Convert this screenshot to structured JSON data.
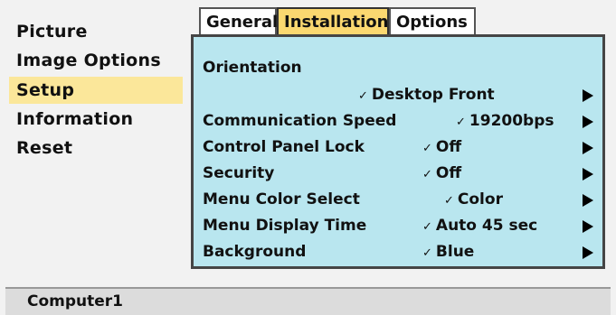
{
  "menu": {
    "items": [
      {
        "label": "Picture",
        "selected": false
      },
      {
        "label": "Image Options",
        "selected": false
      },
      {
        "label": "Setup",
        "selected": true
      },
      {
        "label": "Information",
        "selected": false
      },
      {
        "label": "Reset",
        "selected": false
      }
    ]
  },
  "tabs": [
    {
      "label": "General",
      "active": false
    },
    {
      "label": "Installation",
      "active": true
    },
    {
      "label": "Options",
      "active": false
    }
  ],
  "panel": {
    "orientation": {
      "label": "Orientation",
      "value": "Desktop Front"
    },
    "settings": [
      {
        "label": "Communication Speed",
        "value": "19200bps"
      },
      {
        "label": "Control Panel Lock",
        "value": "Off"
      },
      {
        "label": "Security",
        "value": "Off"
      },
      {
        "label": "Menu Color Select",
        "value": "Color"
      },
      {
        "label": "Menu Display Time",
        "value": "Auto 45 sec"
      },
      {
        "label": "Background",
        "value": "Blue"
      }
    ]
  },
  "status": {
    "source": "Computer1"
  },
  "colors": {
    "selected_menu_bg": "#fbe79a",
    "active_tab_bg": "#fbd870",
    "panel_bg": "#b9e6ef"
  },
  "icons": {
    "check": "check-icon",
    "arrow": "right-arrow-icon"
  }
}
